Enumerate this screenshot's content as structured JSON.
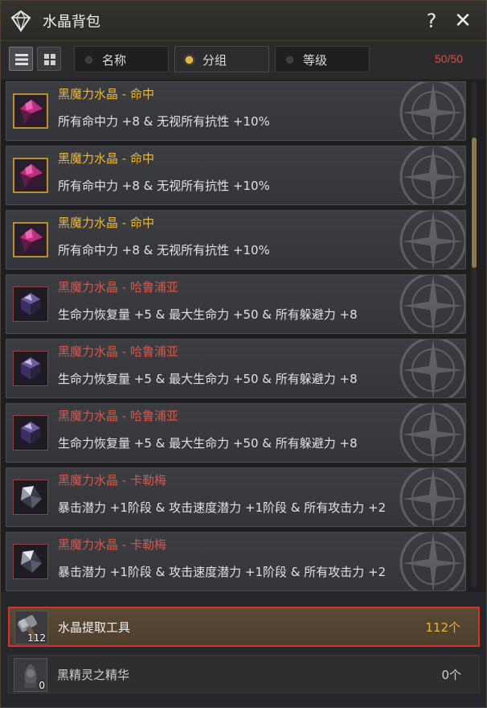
{
  "window": {
    "title": "水晶背包",
    "help_label": "?",
    "close_label": "✕"
  },
  "toolbar": {
    "sort_tabs": [
      {
        "label": "名称",
        "active": false
      },
      {
        "label": "分组",
        "active": true
      },
      {
        "label": "等级",
        "active": false
      }
    ],
    "capacity": "50/50"
  },
  "items": [
    {
      "name": "黑魔力水晶 - 命中",
      "desc": "所有命中力 +8 & 无视所有抗性 +10%",
      "rarity": "gold"
    },
    {
      "name": "黑魔力水晶 - 命中",
      "desc": "所有命中力 +8 & 无视所有抗性 +10%",
      "rarity": "gold"
    },
    {
      "name": "黑魔力水晶 - 命中",
      "desc": "所有命中力 +8 & 无视所有抗性 +10%",
      "rarity": "gold"
    },
    {
      "name": "黑魔力水晶 - 哈鲁浦亚",
      "desc": "生命力恢复量 +5 & 最大生命力 +50 & 所有躲避力 +8",
      "rarity": "red"
    },
    {
      "name": "黑魔力水晶 - 哈鲁浦亚",
      "desc": "生命力恢复量 +5 & 最大生命力 +50 & 所有躲避力 +8",
      "rarity": "red"
    },
    {
      "name": "黑魔力水晶 - 哈鲁浦亚",
      "desc": "生命力恢复量 +5 & 最大生命力 +50 & 所有躲避力 +8",
      "rarity": "red"
    },
    {
      "name": "黑魔力水晶 - 卡勒梅",
      "desc": "暴击潜力 +1阶段 & 攻击速度潜力 +1阶段 & 所有攻击力 +2",
      "rarity": "red"
    },
    {
      "name": "黑魔力水晶 - 卡勒梅",
      "desc": "暴击潜力 +1阶段 & 攻击速度潜力 +1阶段 & 所有攻击力 +2",
      "rarity": "red"
    }
  ],
  "materials": [
    {
      "name": "水晶提取工具",
      "count": "112",
      "qty": "112个",
      "selected": true,
      "icon": "hammer-icon"
    },
    {
      "name": "黑精灵之精华",
      "count": "0",
      "qty": "0个",
      "selected": false,
      "icon": "essence-icon"
    }
  ],
  "colors": {
    "gold": "#e7b93e",
    "red": "#d8574c",
    "capacity": "#e24a3f",
    "highlight_border": "#d8302a"
  }
}
